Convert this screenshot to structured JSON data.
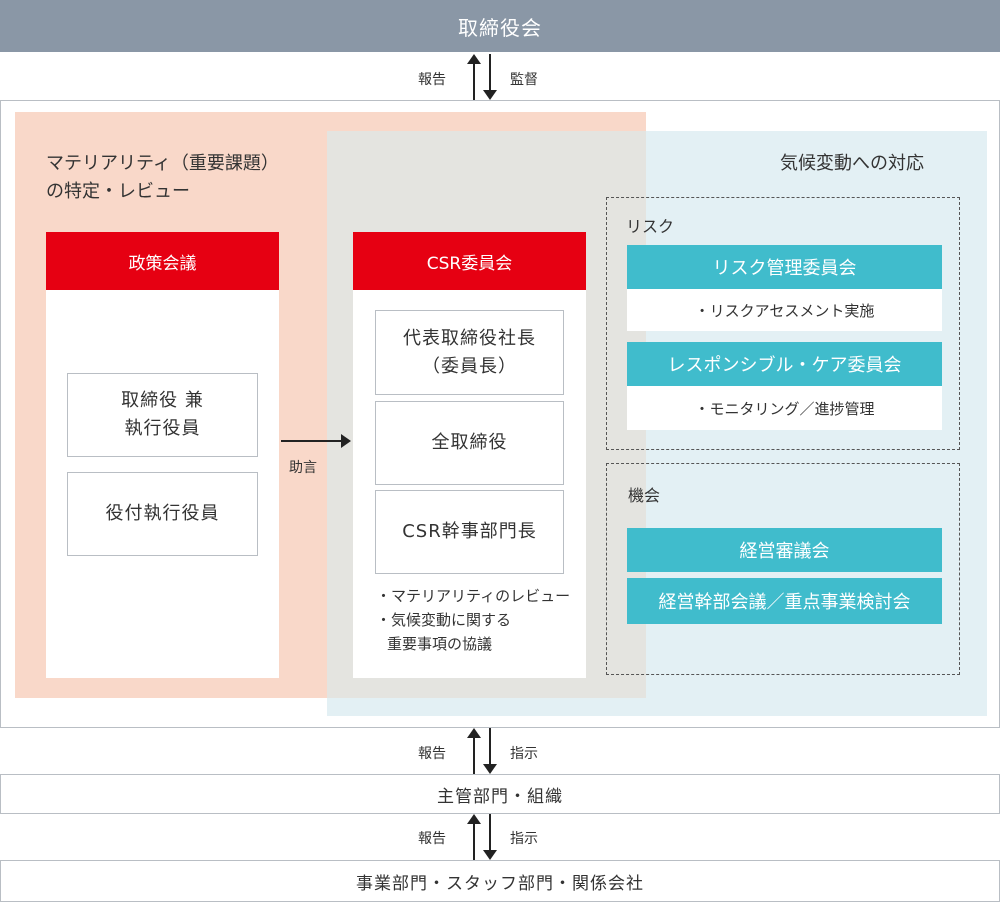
{
  "board": "取締役会",
  "links": {
    "report": "報告",
    "supervise": "監督",
    "instruct": "指示",
    "advise": "助言"
  },
  "materiality": {
    "title_line1": "マテリアリティ（重要課題）",
    "title_line2": "の特定・レビュー",
    "policy_council": "政策会議",
    "box1_line1": "取締役 兼",
    "box1_line2": "執行役員",
    "box2": "役付執行役員"
  },
  "csr": {
    "header": "CSR委員会",
    "box1_line1": "代表取締役社長",
    "box1_line2": "（委員長）",
    "box2": "全取締役",
    "box3": "CSR幹事部門長",
    "note1": "・マテリアリティのレビュー",
    "note2": "・気候変動に関する",
    "note3": "重要事項の協議"
  },
  "climate": {
    "title": "気候変動への対応",
    "risk_label": "リスク",
    "risk_committee": "リスク管理委員会",
    "risk_committee_task": "・リスクアセスメント実施",
    "rc_committee": "レスポンシブル・ケア委員会",
    "rc_committee_task": "・モニタリング／進捗管理",
    "opportunity_label": "機会",
    "mgmt_council": "経営審議会",
    "exec_council": "経営幹部会議／重点事業検討会"
  },
  "bottom": {
    "dept": "主管部門・組織",
    "units": "事業部門・スタッフ部門・関係会社"
  },
  "colors": {
    "board_bg": "#8a97a6",
    "red": "#e60012",
    "teal": "#40bccc",
    "salmon": "#f7cbb7",
    "light_blue": "#e3f0f4",
    "gray_overlap": "#e4e4e0"
  }
}
